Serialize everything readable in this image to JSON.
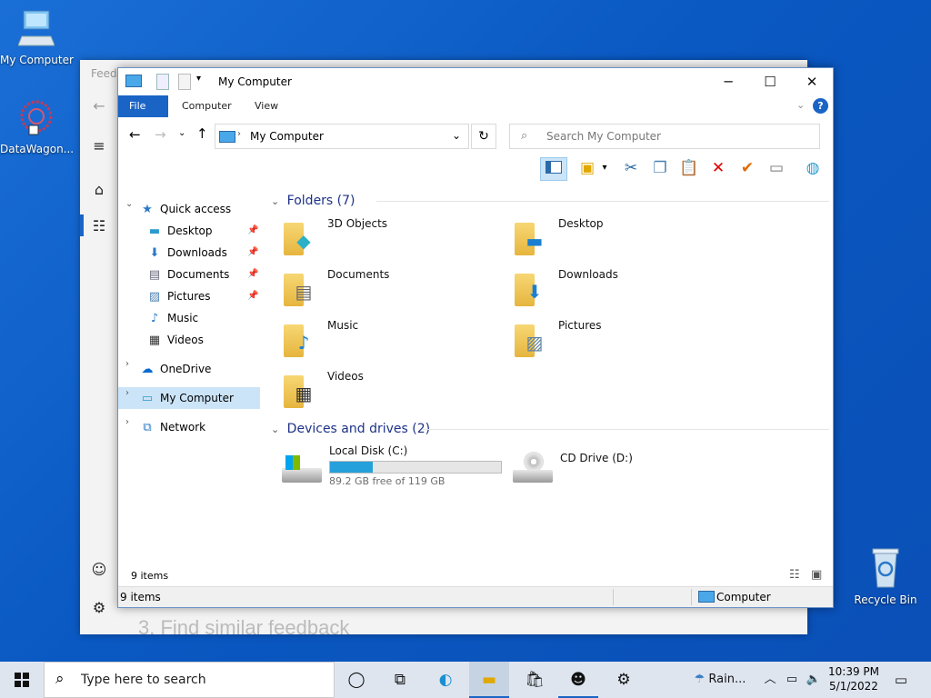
{
  "desktop": {
    "icons": [
      {
        "label": "My Computer"
      },
      {
        "label": "DataWagon..."
      },
      {
        "label": "Recycle Bin"
      }
    ]
  },
  "feedback": {
    "title": "Feedb",
    "bottom_text": "3. Find similar feedback"
  },
  "explorer": {
    "title": "My Computer",
    "ribbon_tabs": [
      "File",
      "Computer",
      "View"
    ],
    "address": "My Computer",
    "search_placeholder": "Search My Computer",
    "nav": {
      "quick_access": "Quick access",
      "quick_items": [
        "Desktop",
        "Downloads",
        "Documents",
        "Pictures",
        "Music",
        "Videos"
      ],
      "onedrive": "OneDrive",
      "my_computer": "My Computer",
      "network": "Network"
    },
    "folders_header": "Folders (7)",
    "folders": [
      "3D Objects",
      "Desktop",
      "Documents",
      "Downloads",
      "Music",
      "Pictures",
      "Videos"
    ],
    "devices_header": "Devices and drives (2)",
    "drives": [
      {
        "name": "Local Disk (C:)",
        "free": "89.2 GB free of 119 GB",
        "used_fraction": 0.25
      },
      {
        "name": "CD Drive (D:)"
      }
    ],
    "status_items": "9 items",
    "status2_items": "9 items",
    "status2_location": "Computer"
  },
  "taskbar": {
    "search_placeholder": "Type here to search",
    "weather": "Rain...",
    "time": "10:39 PM",
    "date": "5/1/2022"
  },
  "colors": {
    "accent": "#1a64c5",
    "selection": "#cce4f7",
    "drive_bar": "#26a0da"
  }
}
